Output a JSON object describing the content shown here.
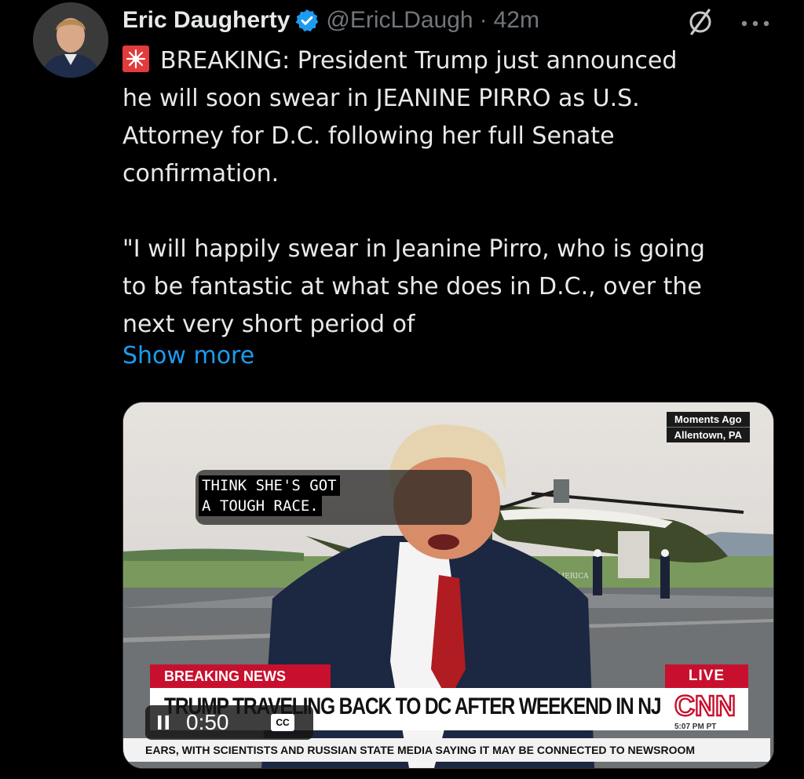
{
  "author": {
    "name": "Eric Daugherty",
    "handle": "@EricLDaugh",
    "separator": "·",
    "time": "42m",
    "avatar_icon": "avatar-photo",
    "verified_icon": "verified-badge-icon",
    "verified_color": "#1d9bf0"
  },
  "actions": {
    "grok_icon": "grok-icon",
    "more_icon": "more-icon"
  },
  "tweet": {
    "emoji_icon": "police-light-icon",
    "lines": [
      "BREAKING: President Trump just announced",
      "he will soon swear in JEANINE PIRRO as U.S.",
      "Attorney for D.C. following her full Senate",
      "confirmation."
    ],
    "lines2": [
      "\"I will happily swear in Jeanine Pirro, who is going",
      "to be fantastic at what she does in D.C., over the",
      "next very short period of"
    ],
    "show_more": "Show more",
    "link_color": "#1d9bf0"
  },
  "video": {
    "location_top": "Moments Ago",
    "location_bottom": "Allentown, PA",
    "caption_line1": "THINK SHE'S GOT",
    "caption_line2": "A TOUGH RACE.",
    "breaking_label": "BREAKING NEWS",
    "live_label": "LIVE",
    "headline": "TRUMP TRAVELING BACK TO DC AFTER WEEKEND IN NJ",
    "network": "CNN",
    "network_time": "5:07 PM PT",
    "ticker": "EARS, WITH SCIENTISTS AND RUSSIAN STATE MEDIA SAYING IT MAY BE CONNECTED TO",
    "ticker_brand": "NEWSROOM",
    "plane_text": "OF AMERICA",
    "elapsed": "0:50",
    "cc_label": "CC",
    "accent_red": "#c8102e"
  }
}
